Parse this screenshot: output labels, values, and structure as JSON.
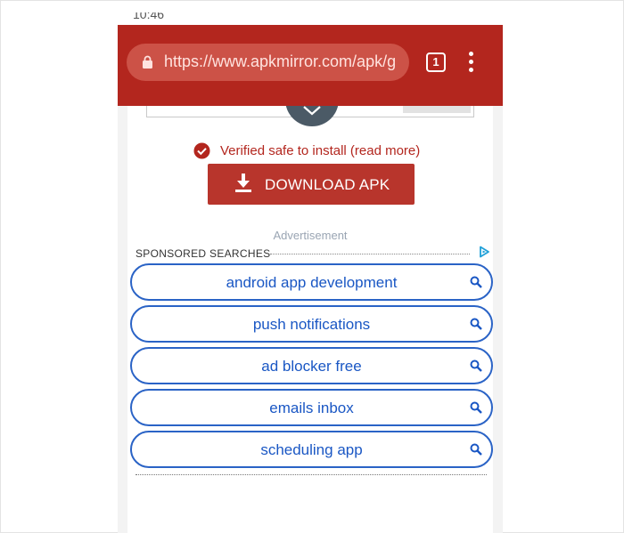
{
  "status_bar": {
    "time": "10:46"
  },
  "browser": {
    "url": "https://www.apkmirror.com/apk/g",
    "tab_count": "1",
    "toolbar_color": "#b3261e"
  },
  "content": {
    "verified_text": "Verified safe to install (read more)",
    "download_label": "DOWNLOAD APK",
    "advertisement_label": "Advertisement",
    "sponsored_label": "SPONSORED SEARCHES",
    "search_items": [
      {
        "label": "android app development",
        "icon": "search-icon"
      },
      {
        "label": "push notifications",
        "icon": "search-icon"
      },
      {
        "label": "ad blocker free",
        "icon": "search-icon"
      },
      {
        "label": "emails inbox",
        "icon": "search-icon"
      },
      {
        "label": "scheduling app",
        "icon": "search-icon"
      }
    ]
  },
  "colors": {
    "accent_red": "#b3261e",
    "link_blue": "#1a57c4"
  }
}
